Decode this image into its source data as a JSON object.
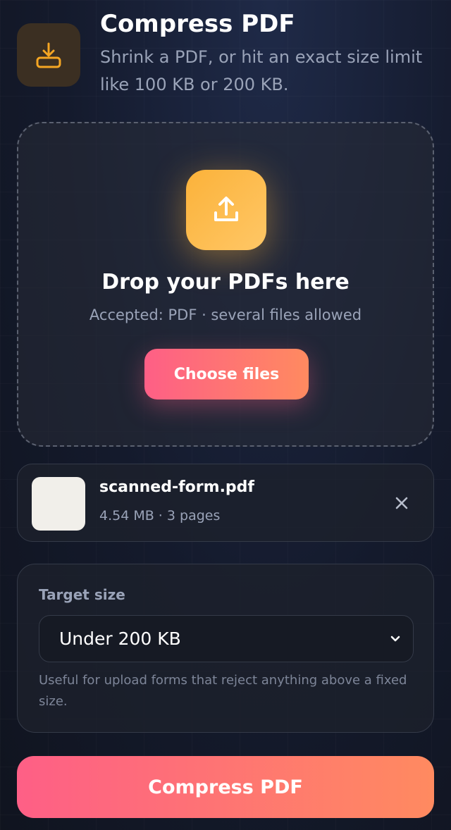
{
  "header": {
    "title": "Compress PDF",
    "subtitle": "Shrink a PDF, or hit an exact size limit like 100 KB or 200 KB.",
    "icon": "download-tray-icon"
  },
  "dropzone": {
    "icon": "upload-icon",
    "title": "Drop your PDFs here",
    "hint": "Accepted: PDF · several files allowed",
    "choose_label": "Choose files"
  },
  "files": [
    {
      "name": "scanned-form.pdf",
      "meta": "4.54 MB · 3 pages"
    }
  ],
  "options": {
    "target_label": "Target size",
    "target_value": "Under 200 KB",
    "help": "Useful for upload forms that reject anything above a fixed size."
  },
  "actions": {
    "compress_label": "Compress PDF"
  },
  "colors": {
    "accent_gradient_start": "#fe5f86",
    "accent_gradient_end": "#ff8a60",
    "upload_badge": "#fbb23a",
    "icon_orange": "#f5a623"
  }
}
